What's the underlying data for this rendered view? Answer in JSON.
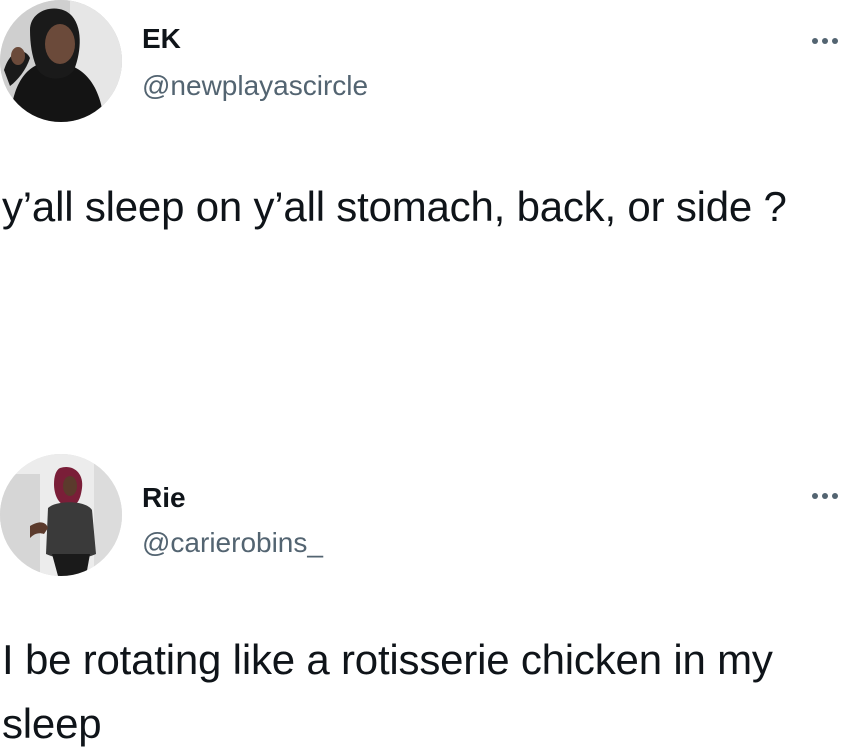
{
  "tweets": [
    {
      "display_name": "EK",
      "handle": "@newplayascircle",
      "text": "y’all sleep on y’all stomach, back, or side ?",
      "more_icon": "more-horizontal-icon",
      "avatar_icon": "avatar-photo"
    },
    {
      "display_name": "Rie",
      "handle": "@carierobins_",
      "text": "I be rotating like a rotisserie chicken in my sleep",
      "more_icon": "more-horizontal-icon",
      "avatar_icon": "avatar-photo"
    }
  ],
  "colors": {
    "text_primary": "#0f1419",
    "text_secondary": "#536471",
    "background": "#ffffff"
  }
}
